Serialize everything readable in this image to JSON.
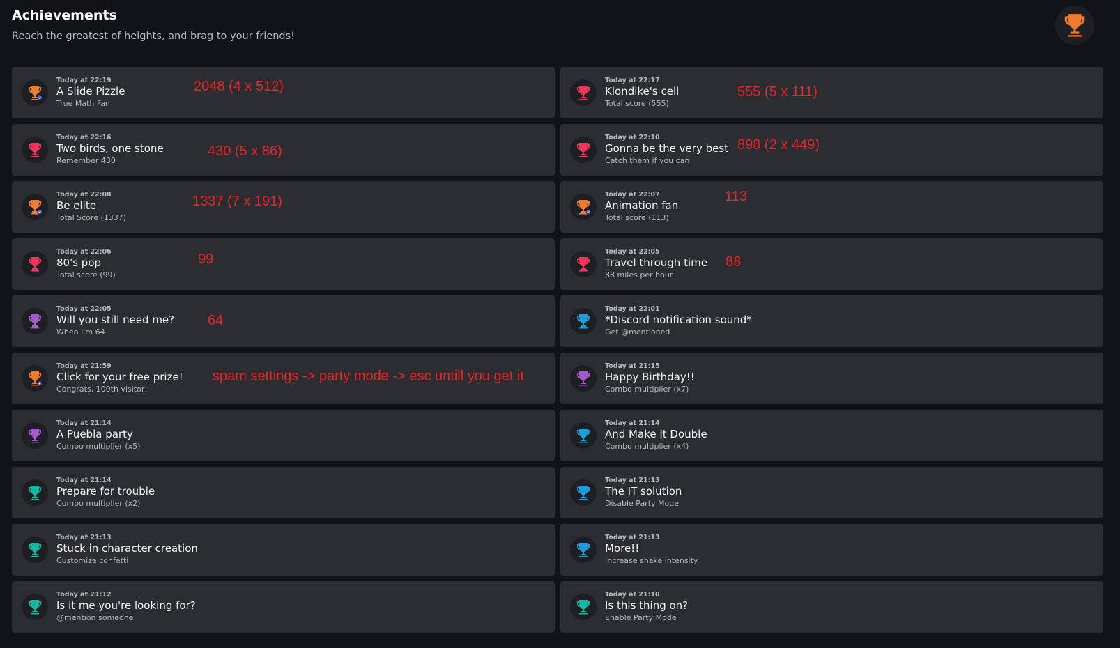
{
  "header": {
    "title": "Achievements",
    "subtitle": "Reach the greatest of heights, and brag to your friends!",
    "trophy_icon": "trophy-icon",
    "trophy_color": "#f07a2e"
  },
  "colors": {
    "orange": "#f07a2e",
    "pink": "#f0355a",
    "purple": "#a35bc9",
    "teal": "#13b8a0",
    "blue": "#1e9ddb",
    "annotation": "#e5262c"
  },
  "achievements": [
    {
      "time": "Today at 22:19",
      "name": "A Slide Pizzle",
      "desc": "True Math Fan",
      "color": "#f07a2e",
      "badge": true,
      "note": "2048 (4 x 512)"
    },
    {
      "time": "Today at 22:17",
      "name": "Klondike's cell",
      "desc": "Total score (555)",
      "color": "#f0355a",
      "badge": false,
      "note": "555 (5 x 111)"
    },
    {
      "time": "Today at 22:16",
      "name": "Two birds, one stone",
      "desc": "Remember 430",
      "color": "#f0355a",
      "badge": false,
      "note": "430 (5 x 86)"
    },
    {
      "time": "Today at 22:10",
      "name": "Gonna be the very best",
      "desc": "Catch them if you can",
      "color": "#f0355a",
      "badge": false,
      "note": "898 (2 x 449)"
    },
    {
      "time": "Today at 22:08",
      "name": "Be elite",
      "desc": "Total Score (1337)",
      "color": "#f07a2e",
      "badge": true,
      "note": "1337 (7 x 191)"
    },
    {
      "time": "Today at 22:07",
      "name": "Animation fan",
      "desc": "Total score (113)",
      "color": "#f07a2e",
      "badge": true,
      "note": "113"
    },
    {
      "time": "Today at 22:06",
      "name": "80's pop",
      "desc": "Total score (99)",
      "color": "#f0355a",
      "badge": false,
      "note": "99"
    },
    {
      "time": "Today at 22:05",
      "name": "Travel through time",
      "desc": "88 miles per hour",
      "color": "#f0355a",
      "badge": false,
      "note": "88"
    },
    {
      "time": "Today at 22:05",
      "name": "Will you still need me?",
      "desc": "When I'm 64",
      "color": "#a35bc9",
      "badge": false,
      "note": "64"
    },
    {
      "time": "Today at 22:01",
      "name": "*Discord notification sound*",
      "desc": "Get @mentioned",
      "color": "#1e9ddb",
      "badge": false,
      "note": ""
    },
    {
      "time": "Today at 21:59",
      "name": "Click for your free prize!",
      "desc": "Congrats, 100th visitor!",
      "color": "#f07a2e",
      "badge": true,
      "note": "spam settings -> party mode -> esc untill you get it"
    },
    {
      "time": "Today at 21:15",
      "name": "Happy Birthday!!",
      "desc": "Combo multiplier (x7)",
      "color": "#a35bc9",
      "badge": false,
      "note": ""
    },
    {
      "time": "Today at 21:14",
      "name": "A Puebla party",
      "desc": "Combo multiplier (x5)",
      "color": "#a35bc9",
      "badge": false,
      "note": ""
    },
    {
      "time": "Today at 21:14",
      "name": "And Make It Double",
      "desc": "Combo multiplier (x4)",
      "color": "#1e9ddb",
      "badge": false,
      "note": ""
    },
    {
      "time": "Today at 21:14",
      "name": "Prepare for trouble",
      "desc": "Combo multiplier (x2)",
      "color": "#13b8a0",
      "badge": false,
      "note": ""
    },
    {
      "time": "Today at 21:13",
      "name": "The IT solution",
      "desc": "Disable Party Mode",
      "color": "#1e9ddb",
      "badge": false,
      "note": ""
    },
    {
      "time": "Today at 21:13",
      "name": "Stuck in character creation",
      "desc": "Customize confetti",
      "color": "#13b8a0",
      "badge": false,
      "note": ""
    },
    {
      "time": "Today at 21:13",
      "name": "More!!",
      "desc": "Increase shake intensity",
      "color": "#1e9ddb",
      "badge": false,
      "note": ""
    },
    {
      "time": "Today at 21:12",
      "name": "Is it me you're looking for?",
      "desc": "@mention someone",
      "color": "#13b8a0",
      "badge": false,
      "note": ""
    },
    {
      "time": "Today at 21:10",
      "name": "Is this thing on?",
      "desc": "Enable Party Mode",
      "color": "#13b8a0",
      "badge": false,
      "note": ""
    }
  ]
}
